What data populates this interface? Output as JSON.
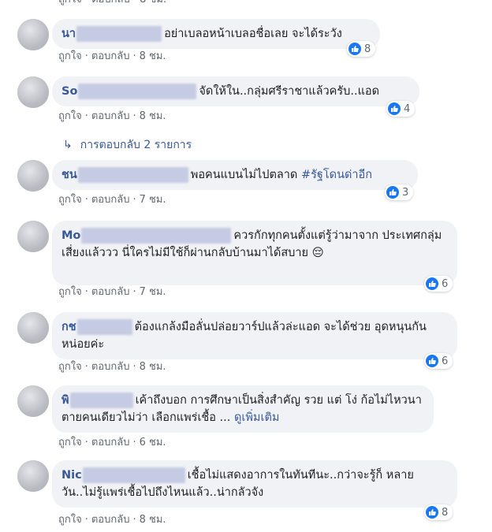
{
  "top": {
    "text": "ถูกใจ · ตอบกลับ · 8 ชม."
  },
  "like_label": "ถูกใจ",
  "reply_label": "ตอบกลับ",
  "sep": "·",
  "comments": [
    {
      "author": "นา",
      "text": "อย่าเบลอหน้าเบลอชื่อเลย จะได้ระวัง",
      "likes": "8",
      "time": "8 ชม."
    },
    {
      "author": "So",
      "text": "จัดให้ใน..กลุ่มศรีราชาแล้วครับ..แอด",
      "likes": "4",
      "time": "8 ชม."
    },
    {
      "author": "ชน",
      "text": "พอคนแบนไม่ไปตลาด ",
      "hashtag": "#รัฐโดนด่าอีก",
      "likes": "3",
      "time": "7 ชม."
    },
    {
      "author": "Mo",
      "text": "ควรกักทุกคนตั้งแต่รู้ว่ามาจาก ประเทศกลุ่มเสี่ยงแล้ววว นี่ใครไม่มีใช้ก็ผ่านกลับบ้านมาได้สบาย",
      "emoji": "😔",
      "likes": "6",
      "time": "7 ชม."
    },
    {
      "author": "กช",
      "text": "ต้องแกล้งมือลั่นปล่อยวาร์ปแล้วล่ะแอด จะได้ช่วย อุดหนุนกันหน่อยค่ะ",
      "likes": "6",
      "time": "8 ชม."
    },
    {
      "author": "พิ",
      "text": "เค้าถึงบอก การศึกษาเป็นสิ่งสำคัญ รวย แต่ โง่ ก้อไม่ไหวนา ตายคนเดียวไม่ว่า เลือกแพร่เชื้อ ... ",
      "see_more": "ดูเพิ่มเติม",
      "time": "6 ชม."
    },
    {
      "author": "Nic",
      "text": "เชื้อไม่แสดงอาการในทันทีนะ..กว่าจะรู้ก็ หลายวัน..ไม่รู้แพร่เชื้อไปถึงไหนแล้ว..น่ากลัวจัง",
      "likes": "8",
      "time": "8 ชม."
    }
  ],
  "replies_link": "การตอบกลับ 2 รายการ"
}
